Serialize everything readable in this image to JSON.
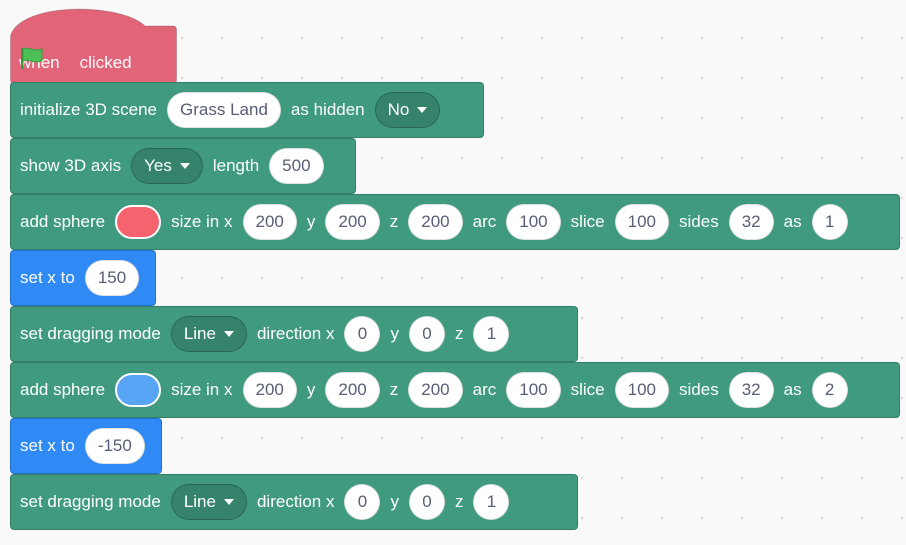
{
  "hat": {
    "when": "when",
    "clicked": "clicked",
    "flag_icon": "green-flag-icon"
  },
  "colors": {
    "hat": "#e26478",
    "extension": "#3f9a80",
    "motion": "#2f8af5",
    "sphere1": "#f5646e",
    "sphere2": "#59a5f5"
  },
  "blocks": {
    "init": {
      "label": "initialize 3D scene",
      "scene": "Grass Land",
      "as_hidden": "as hidden",
      "hidden_value": "No"
    },
    "axis": {
      "label": "show 3D axis",
      "value": "Yes",
      "length_label": "length",
      "length": "500"
    },
    "sphere1": {
      "label": "add sphere",
      "size_label": "size in x",
      "x": "200",
      "y_label": "y",
      "y": "200",
      "z_label": "z",
      "z": "200",
      "arc_label": "arc",
      "arc": "100",
      "slice_label": "slice",
      "slice": "100",
      "sides_label": "sides",
      "sides": "32",
      "as_label": "as",
      "as": "1"
    },
    "setx1": {
      "label": "set x to",
      "value": "150"
    },
    "drag1": {
      "label": "set dragging mode",
      "mode": "Line",
      "dir_label": "direction x",
      "x": "0",
      "y_label": "y",
      "y": "0",
      "z_label": "z",
      "z": "1"
    },
    "sphere2": {
      "label": "add sphere",
      "size_label": "size in x",
      "x": "200",
      "y_label": "y",
      "y": "200",
      "z_label": "z",
      "z": "200",
      "arc_label": "arc",
      "arc": "100",
      "slice_label": "slice",
      "slice": "100",
      "sides_label": "sides",
      "sides": "32",
      "as_label": "as",
      "as": "2"
    },
    "setx2": {
      "label": "set x to",
      "value": "-150"
    },
    "drag2": {
      "label": "set dragging mode",
      "mode": "Line",
      "dir_label": "direction x",
      "x": "0",
      "y_label": "y",
      "y": "0",
      "z_label": "z",
      "z": "1"
    }
  }
}
